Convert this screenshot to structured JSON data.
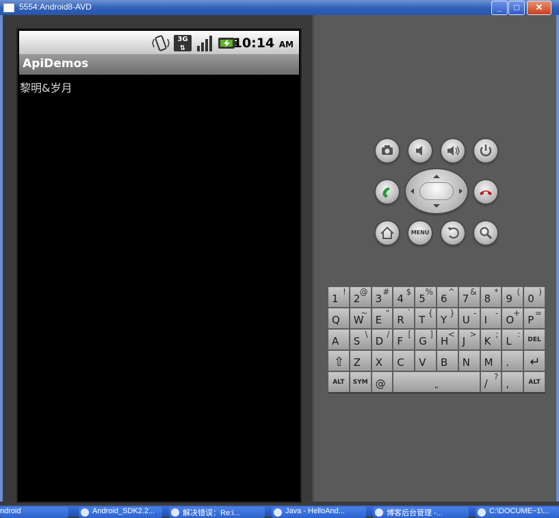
{
  "window": {
    "title": "5554:Android8-AVD",
    "minimize": "_",
    "maximize": "□",
    "close": "✕"
  },
  "device": {
    "status": {
      "time": "10:14",
      "ampm": "AM",
      "network": "3G"
    },
    "app_title": "ApiDemos",
    "content_text": "黎明&岁月"
  },
  "controls": {
    "menu_label": "MENU"
  },
  "keyboard": {
    "rows": [
      [
        [
          "1",
          "!"
        ],
        [
          "2",
          "@"
        ],
        [
          "3",
          "#"
        ],
        [
          "4",
          "$"
        ],
        [
          "5",
          "%"
        ],
        [
          "6",
          "^"
        ],
        [
          "7",
          "&"
        ],
        [
          "8",
          "*"
        ],
        [
          "9",
          "("
        ],
        [
          "0",
          ")"
        ]
      ],
      [
        [
          "Q",
          ""
        ],
        [
          "W",
          "~"
        ],
        [
          "E",
          "\""
        ],
        [
          "R",
          "`"
        ],
        [
          "T",
          "{"
        ],
        [
          "Y",
          "}"
        ],
        [
          "U",
          "-"
        ],
        [
          "I",
          "-"
        ],
        [
          "O",
          "+"
        ],
        [
          "P",
          "="
        ]
      ],
      [
        [
          "A",
          ""
        ],
        [
          "S",
          "\\"
        ],
        [
          "D",
          "/"
        ],
        [
          "F",
          "["
        ],
        [
          "G",
          "]"
        ],
        [
          "H",
          "<"
        ],
        [
          "J",
          ">"
        ],
        [
          "K",
          ";"
        ],
        [
          "L",
          ":"
        ],
        [
          "DEL",
          ""
        ]
      ],
      [
        [
          "⇧",
          ""
        ],
        [
          "Z",
          ""
        ],
        [
          "X",
          ""
        ],
        [
          "C",
          ""
        ],
        [
          "V",
          ""
        ],
        [
          "B",
          ""
        ],
        [
          "N",
          ""
        ],
        [
          "M",
          ""
        ],
        [
          ".",
          ""
        ],
        [
          "↵",
          ""
        ]
      ],
      [
        [
          "ALT",
          ""
        ],
        [
          "SYM",
          ""
        ],
        [
          "@",
          ""
        ],
        [
          "SPACE",
          ""
        ],
        [
          "/",
          "?"
        ],
        [
          ",",
          ""
        ],
        [
          "ALT",
          ""
        ]
      ]
    ]
  },
  "taskbar": {
    "items": [
      "ndroid",
      "Android_SDK2.2...",
      "解决错误：Re:i...",
      "Java - HelloAnd...",
      "博客后台管理 -...",
      "C:\\DOCUME~1\\..."
    ]
  }
}
